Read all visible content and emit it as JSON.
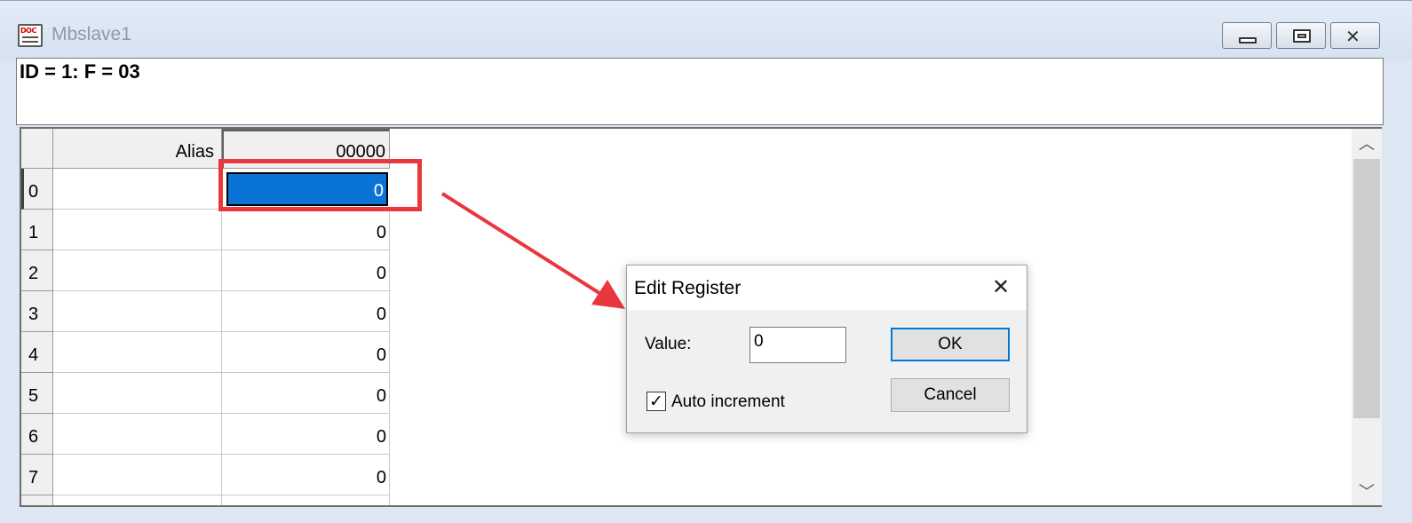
{
  "window": {
    "title": "Mbslave1",
    "minimize_icon": "minimize-icon",
    "restore_icon": "restore-icon",
    "close_icon": "close-icon",
    "app_icon": "doc-icon",
    "app_icon_text": "DOC"
  },
  "header": {
    "info": "ID = 1: F = 03"
  },
  "grid": {
    "columns": [
      "Alias",
      "00000"
    ],
    "rows": [
      {
        "index": "0",
        "alias": "",
        "value": "0"
      },
      {
        "index": "1",
        "alias": "",
        "value": "0"
      },
      {
        "index": "2",
        "alias": "",
        "value": "0"
      },
      {
        "index": "3",
        "alias": "",
        "value": "0"
      },
      {
        "index": "4",
        "alias": "",
        "value": "0"
      },
      {
        "index": "5",
        "alias": "",
        "value": "0"
      },
      {
        "index": "6",
        "alias": "",
        "value": "0"
      },
      {
        "index": "7",
        "alias": "",
        "value": "0"
      }
    ],
    "selected_row": 0
  },
  "scrollbar": {
    "up_glyph": "︿",
    "down_glyph": "﹀"
  },
  "dialog": {
    "title": "Edit Register",
    "close_glyph": "✕",
    "value_label": "Value:",
    "value": "0",
    "auto_increment_label": "Auto increment",
    "auto_increment_checked": true,
    "check_glyph": "✓",
    "ok_label": "OK",
    "cancel_label": "Cancel"
  },
  "annotation": {
    "color": "#e8383d"
  },
  "colors": {
    "selection": "#0a74d6",
    "default_button_border": "#0078d7"
  }
}
